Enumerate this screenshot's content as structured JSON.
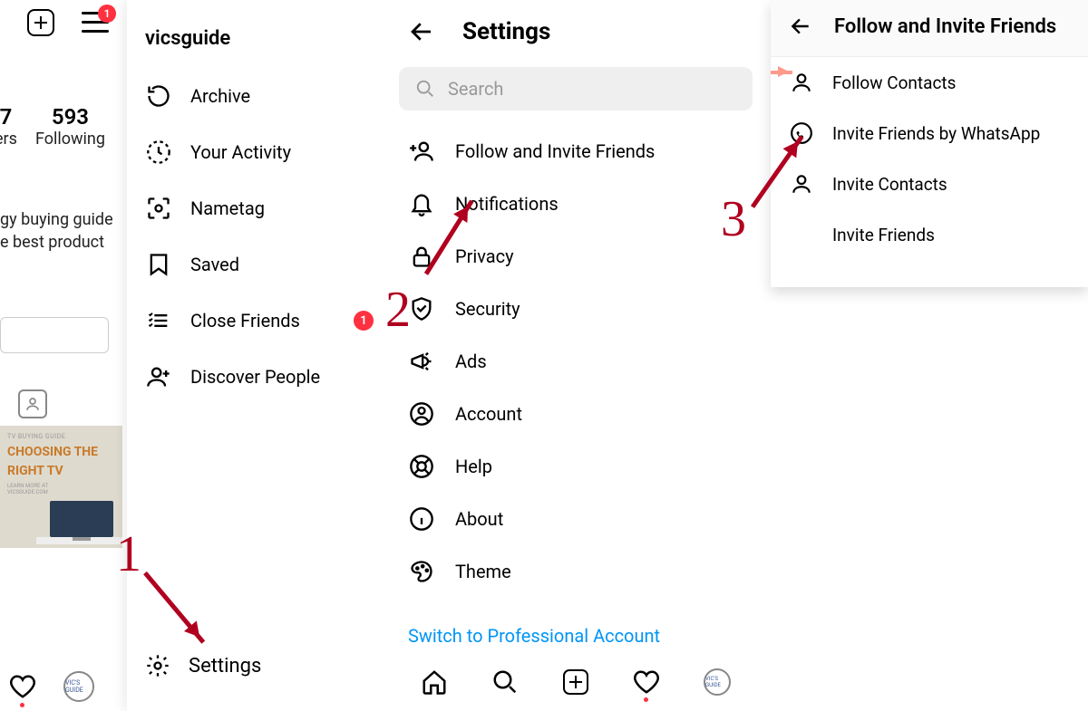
{
  "annotations": {
    "step1": "1",
    "step2": "2",
    "step3": "3",
    "color": "#b00020"
  },
  "profile": {
    "username": "vicsguide",
    "stats": [
      {
        "value": "7",
        "label": "ers"
      },
      {
        "value": "593",
        "label": "Following"
      }
    ],
    "bio_line1": "gy buying guide",
    "bio_line2": "e best product",
    "nav_badge": "1",
    "avatar_text": "VIC'S GUIDE"
  },
  "thumb": {
    "caption": "TV BUYING GUIDE",
    "title1": "CHOOSING THE",
    "title2": "RIGHT TV",
    "sub1": "LEARN MORE AT",
    "sub2": "VICSGUIDE.COM"
  },
  "drawer": {
    "items": [
      {
        "icon": "archive",
        "label": "Archive"
      },
      {
        "icon": "activity",
        "label": "Your Activity"
      },
      {
        "icon": "nametag",
        "label": "Nametag"
      },
      {
        "icon": "saved",
        "label": "Saved"
      },
      {
        "icon": "close-friends",
        "label": "Close Friends",
        "badge": "1"
      },
      {
        "icon": "discover",
        "label": "Discover People"
      }
    ],
    "settings_label": "Settings"
  },
  "settings": {
    "title": "Settings",
    "search_placeholder": "Search",
    "items": [
      {
        "icon": "invite",
        "label": "Follow and Invite Friends"
      },
      {
        "icon": "bell",
        "label": "Notifications"
      },
      {
        "icon": "lock",
        "label": "Privacy"
      },
      {
        "icon": "shield",
        "label": "Security"
      },
      {
        "icon": "megaphone",
        "label": "Ads"
      },
      {
        "icon": "account",
        "label": "Account"
      },
      {
        "icon": "help",
        "label": "Help"
      },
      {
        "icon": "info",
        "label": "About"
      },
      {
        "icon": "theme",
        "label": "Theme"
      }
    ],
    "switch_label": "Switch to Professional Account"
  },
  "follow_invite": {
    "title": "Follow and Invite Friends",
    "items": [
      {
        "icon": "person",
        "label": "Follow Contacts"
      },
      {
        "icon": "whatsapp",
        "label": "Invite Friends by WhatsApp"
      },
      {
        "icon": "person",
        "label": "Invite Contacts"
      },
      {
        "icon": "",
        "label": "Invite Friends"
      }
    ]
  }
}
